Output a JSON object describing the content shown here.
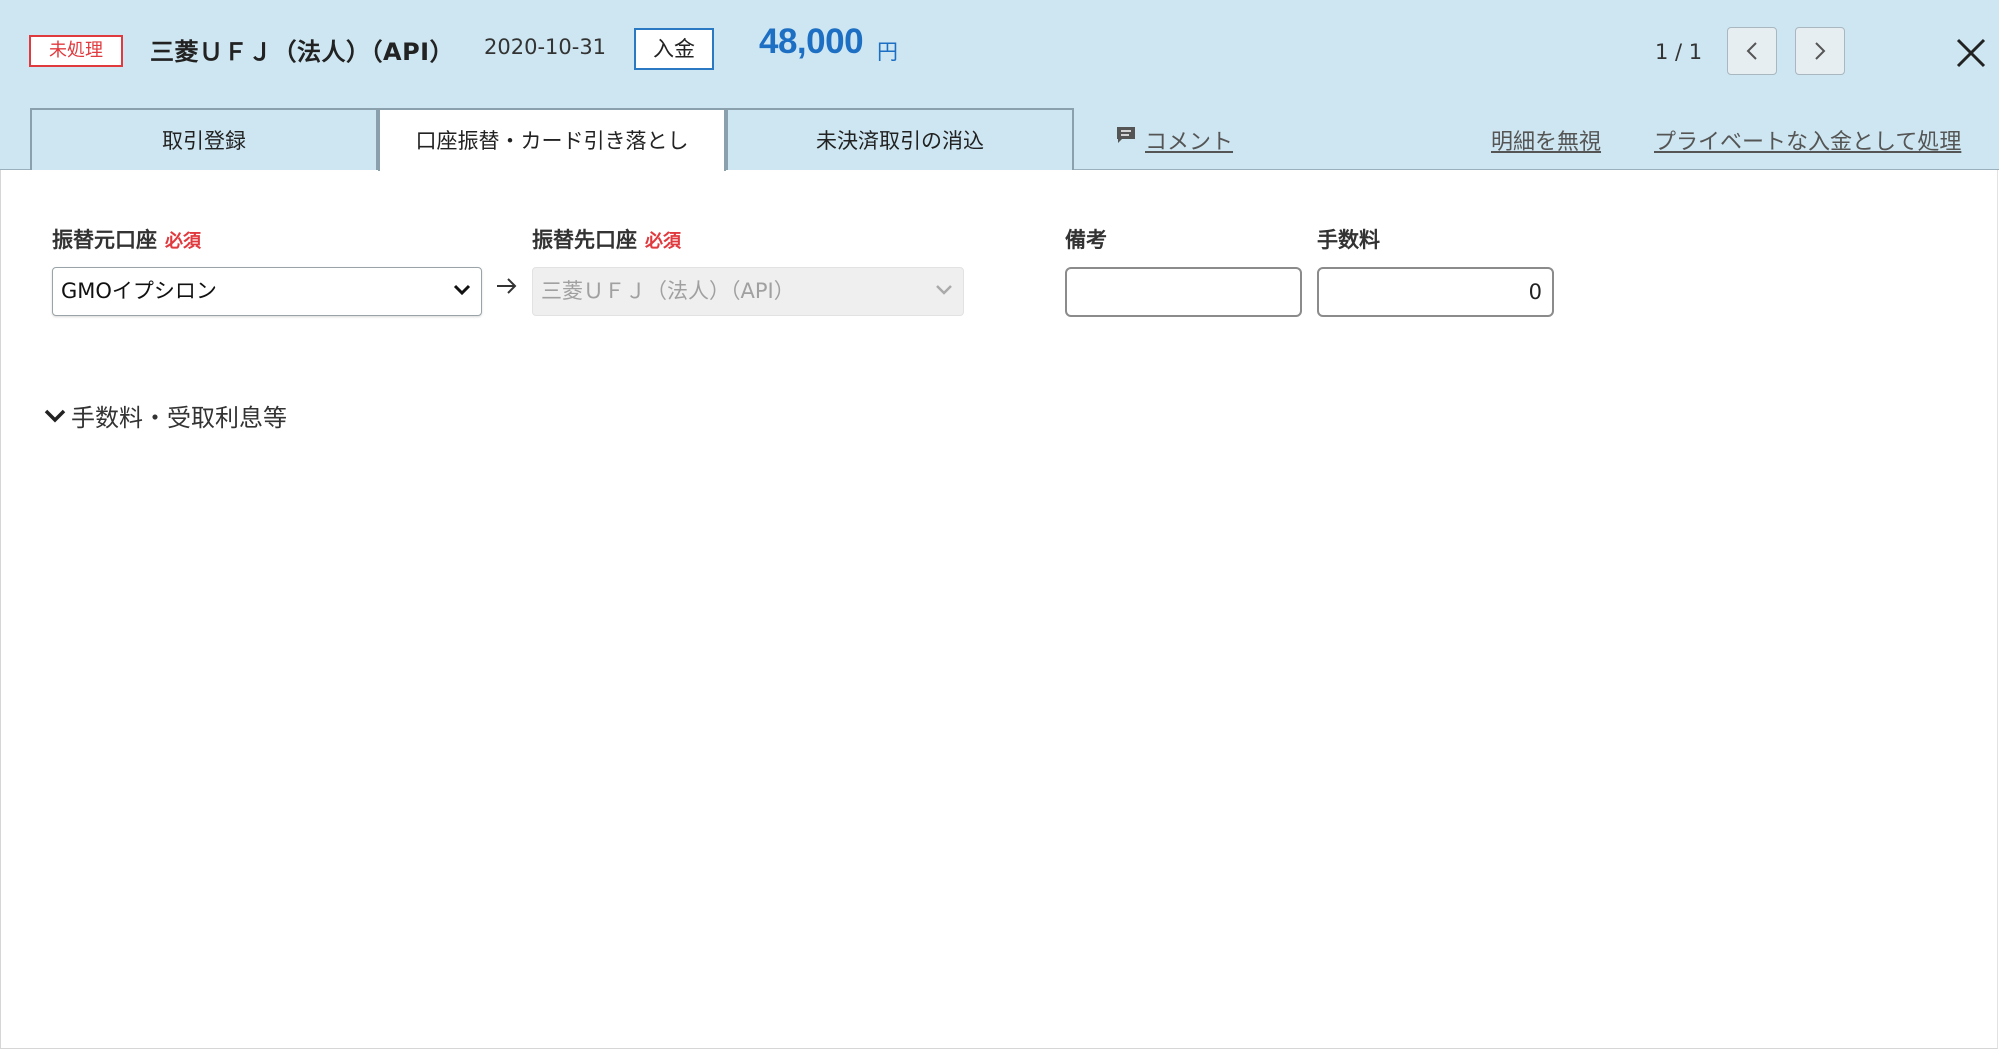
{
  "header": {
    "status": "未処理",
    "account": "三菱ＵＦＪ（法人）（API）",
    "date": "2020-10-31",
    "type": "入金",
    "amount": "48,000",
    "currency": "円",
    "pager": "1 / 1"
  },
  "tabs": [
    "取引登録",
    "口座振替・カード引き落とし",
    "未決済取引の消込"
  ],
  "links": {
    "comment": "コメント",
    "ignore": "明細を無視",
    "private": "プライベートな入金として処理"
  },
  "form": {
    "from_label": "振替元口座",
    "from_required": "必須",
    "from_value": "GMOイプシロン",
    "to_label": "振替先口座",
    "to_required": "必須",
    "to_value": "三菱ＵＦＪ（法人）（API）",
    "memo_label": "備考",
    "memo_value": "",
    "fee_label": "手数料",
    "fee_value": "0"
  },
  "expander": "手数料・受取利息等",
  "colors": {
    "header_bg": "#cde6f1",
    "status_red": "#e03a3e",
    "amount_blue": "#1d6fc4",
    "type_border": "#2b79c2"
  }
}
